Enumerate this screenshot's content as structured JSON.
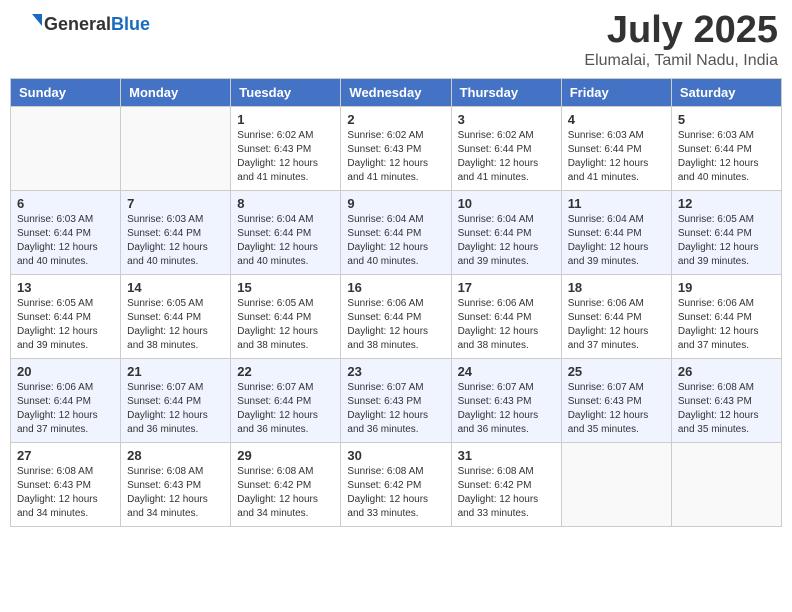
{
  "header": {
    "logo_general": "General",
    "logo_blue": "Blue",
    "month": "July 2025",
    "location": "Elumalai, Tamil Nadu, India"
  },
  "days_of_week": [
    "Sunday",
    "Monday",
    "Tuesday",
    "Wednesday",
    "Thursday",
    "Friday",
    "Saturday"
  ],
  "weeks": [
    [
      {
        "day": "",
        "sunrise": "",
        "sunset": "",
        "daylight": ""
      },
      {
        "day": "",
        "sunrise": "",
        "sunset": "",
        "daylight": ""
      },
      {
        "day": "1",
        "sunrise": "Sunrise: 6:02 AM",
        "sunset": "Sunset: 6:43 PM",
        "daylight": "Daylight: 12 hours and 41 minutes."
      },
      {
        "day": "2",
        "sunrise": "Sunrise: 6:02 AM",
        "sunset": "Sunset: 6:43 PM",
        "daylight": "Daylight: 12 hours and 41 minutes."
      },
      {
        "day": "3",
        "sunrise": "Sunrise: 6:02 AM",
        "sunset": "Sunset: 6:44 PM",
        "daylight": "Daylight: 12 hours and 41 minutes."
      },
      {
        "day": "4",
        "sunrise": "Sunrise: 6:03 AM",
        "sunset": "Sunset: 6:44 PM",
        "daylight": "Daylight: 12 hours and 41 minutes."
      },
      {
        "day": "5",
        "sunrise": "Sunrise: 6:03 AM",
        "sunset": "Sunset: 6:44 PM",
        "daylight": "Daylight: 12 hours and 40 minutes."
      }
    ],
    [
      {
        "day": "6",
        "sunrise": "Sunrise: 6:03 AM",
        "sunset": "Sunset: 6:44 PM",
        "daylight": "Daylight: 12 hours and 40 minutes."
      },
      {
        "day": "7",
        "sunrise": "Sunrise: 6:03 AM",
        "sunset": "Sunset: 6:44 PM",
        "daylight": "Daylight: 12 hours and 40 minutes."
      },
      {
        "day": "8",
        "sunrise": "Sunrise: 6:04 AM",
        "sunset": "Sunset: 6:44 PM",
        "daylight": "Daylight: 12 hours and 40 minutes."
      },
      {
        "day": "9",
        "sunrise": "Sunrise: 6:04 AM",
        "sunset": "Sunset: 6:44 PM",
        "daylight": "Daylight: 12 hours and 40 minutes."
      },
      {
        "day": "10",
        "sunrise": "Sunrise: 6:04 AM",
        "sunset": "Sunset: 6:44 PM",
        "daylight": "Daylight: 12 hours and 39 minutes."
      },
      {
        "day": "11",
        "sunrise": "Sunrise: 6:04 AM",
        "sunset": "Sunset: 6:44 PM",
        "daylight": "Daylight: 12 hours and 39 minutes."
      },
      {
        "day": "12",
        "sunrise": "Sunrise: 6:05 AM",
        "sunset": "Sunset: 6:44 PM",
        "daylight": "Daylight: 12 hours and 39 minutes."
      }
    ],
    [
      {
        "day": "13",
        "sunrise": "Sunrise: 6:05 AM",
        "sunset": "Sunset: 6:44 PM",
        "daylight": "Daylight: 12 hours and 39 minutes."
      },
      {
        "day": "14",
        "sunrise": "Sunrise: 6:05 AM",
        "sunset": "Sunset: 6:44 PM",
        "daylight": "Daylight: 12 hours and 38 minutes."
      },
      {
        "day": "15",
        "sunrise": "Sunrise: 6:05 AM",
        "sunset": "Sunset: 6:44 PM",
        "daylight": "Daylight: 12 hours and 38 minutes."
      },
      {
        "day": "16",
        "sunrise": "Sunrise: 6:06 AM",
        "sunset": "Sunset: 6:44 PM",
        "daylight": "Daylight: 12 hours and 38 minutes."
      },
      {
        "day": "17",
        "sunrise": "Sunrise: 6:06 AM",
        "sunset": "Sunset: 6:44 PM",
        "daylight": "Daylight: 12 hours and 38 minutes."
      },
      {
        "day": "18",
        "sunrise": "Sunrise: 6:06 AM",
        "sunset": "Sunset: 6:44 PM",
        "daylight": "Daylight: 12 hours and 37 minutes."
      },
      {
        "day": "19",
        "sunrise": "Sunrise: 6:06 AM",
        "sunset": "Sunset: 6:44 PM",
        "daylight": "Daylight: 12 hours and 37 minutes."
      }
    ],
    [
      {
        "day": "20",
        "sunrise": "Sunrise: 6:06 AM",
        "sunset": "Sunset: 6:44 PM",
        "daylight": "Daylight: 12 hours and 37 minutes."
      },
      {
        "day": "21",
        "sunrise": "Sunrise: 6:07 AM",
        "sunset": "Sunset: 6:44 PM",
        "daylight": "Daylight: 12 hours and 36 minutes."
      },
      {
        "day": "22",
        "sunrise": "Sunrise: 6:07 AM",
        "sunset": "Sunset: 6:44 PM",
        "daylight": "Daylight: 12 hours and 36 minutes."
      },
      {
        "day": "23",
        "sunrise": "Sunrise: 6:07 AM",
        "sunset": "Sunset: 6:43 PM",
        "daylight": "Daylight: 12 hours and 36 minutes."
      },
      {
        "day": "24",
        "sunrise": "Sunrise: 6:07 AM",
        "sunset": "Sunset: 6:43 PM",
        "daylight": "Daylight: 12 hours and 36 minutes."
      },
      {
        "day": "25",
        "sunrise": "Sunrise: 6:07 AM",
        "sunset": "Sunset: 6:43 PM",
        "daylight": "Daylight: 12 hours and 35 minutes."
      },
      {
        "day": "26",
        "sunrise": "Sunrise: 6:08 AM",
        "sunset": "Sunset: 6:43 PM",
        "daylight": "Daylight: 12 hours and 35 minutes."
      }
    ],
    [
      {
        "day": "27",
        "sunrise": "Sunrise: 6:08 AM",
        "sunset": "Sunset: 6:43 PM",
        "daylight": "Daylight: 12 hours and 34 minutes."
      },
      {
        "day": "28",
        "sunrise": "Sunrise: 6:08 AM",
        "sunset": "Sunset: 6:43 PM",
        "daylight": "Daylight: 12 hours and 34 minutes."
      },
      {
        "day": "29",
        "sunrise": "Sunrise: 6:08 AM",
        "sunset": "Sunset: 6:42 PM",
        "daylight": "Daylight: 12 hours and 34 minutes."
      },
      {
        "day": "30",
        "sunrise": "Sunrise: 6:08 AM",
        "sunset": "Sunset: 6:42 PM",
        "daylight": "Daylight: 12 hours and 33 minutes."
      },
      {
        "day": "31",
        "sunrise": "Sunrise: 6:08 AM",
        "sunset": "Sunset: 6:42 PM",
        "daylight": "Daylight: 12 hours and 33 minutes."
      },
      {
        "day": "",
        "sunrise": "",
        "sunset": "",
        "daylight": ""
      },
      {
        "day": "",
        "sunrise": "",
        "sunset": "",
        "daylight": ""
      }
    ]
  ]
}
